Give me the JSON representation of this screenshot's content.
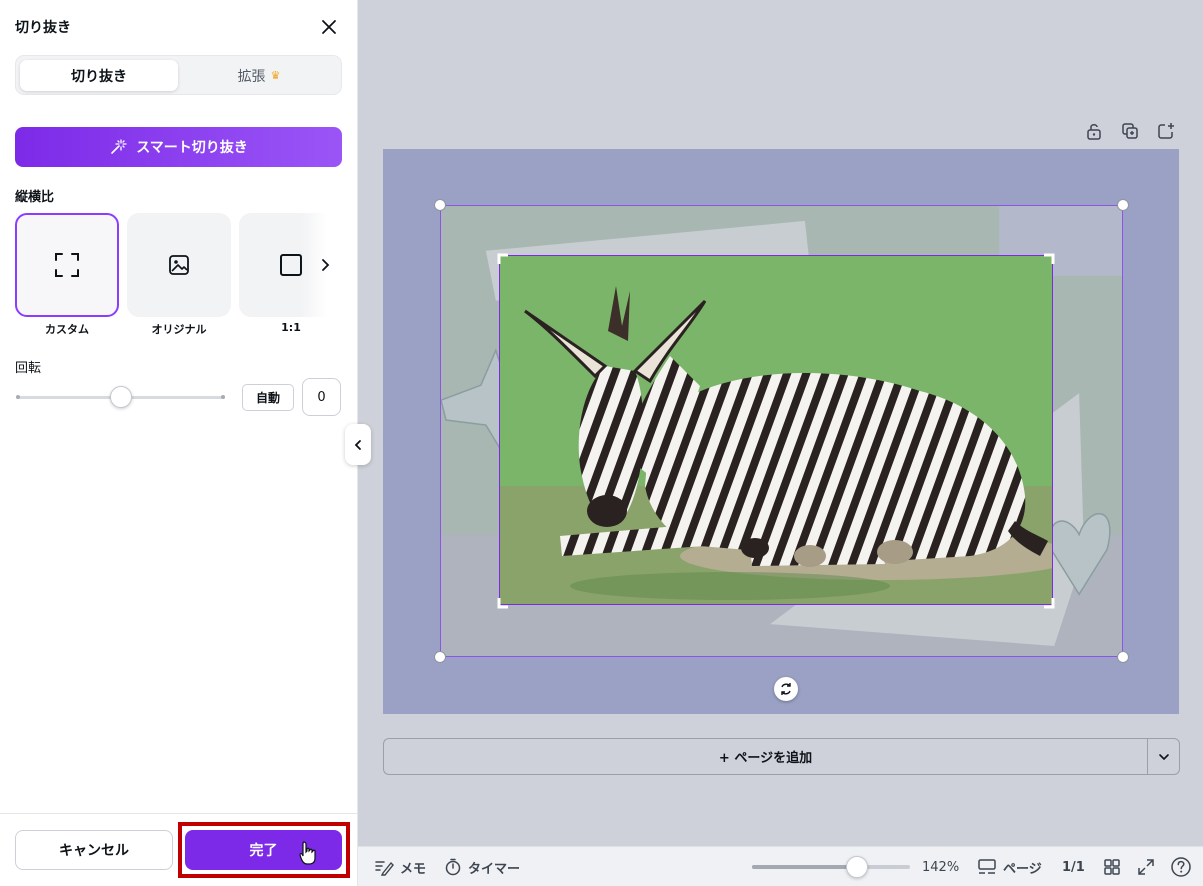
{
  "panel": {
    "title": "切り抜き",
    "tabs": [
      {
        "label": "切り抜き",
        "active": true
      },
      {
        "label": "拡張",
        "badge_icon": "crown-icon",
        "active": false
      }
    ],
    "smart_crop_label": "スマート切り抜き",
    "aspect_title": "縦横比",
    "ratios": [
      {
        "label": "カスタム",
        "icon": "custom-crop-icon",
        "selected": true
      },
      {
        "label": "オリジナル",
        "icon": "image-icon",
        "selected": false
      },
      {
        "label": "1:1",
        "icon": "square-icon",
        "selected": false
      }
    ],
    "rotation_label": "回転",
    "rotation_slider_level": 0.5,
    "auto_label": "自動",
    "rotation_value": "0",
    "cancel_label": "キャンセル",
    "done_label": "完了"
  },
  "canvas": {
    "add_page_label": "+ ページを追加",
    "page_tools": [
      "lock-icon",
      "duplicate-icon",
      "add-page-icon"
    ]
  },
  "bottombar": {
    "notes_label": "メモ",
    "timer_label": "タイマー",
    "zoom_level": 0.6,
    "zoom_value": "142%",
    "pages_label": "ページ",
    "page_count": "1/1"
  },
  "colors": {
    "accent": "#7d2ae8",
    "highlight_frame": "#c00000",
    "page_bg": "#9aa1c4",
    "workspace_bg": "#ced1d9"
  }
}
